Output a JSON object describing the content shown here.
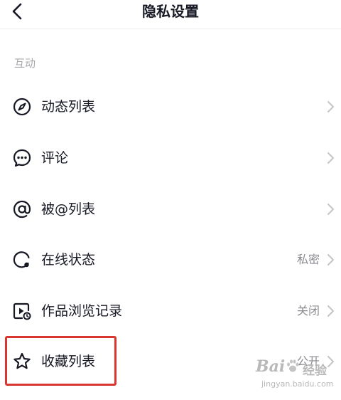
{
  "header": {
    "title": "隐私设置"
  },
  "section": {
    "title": "互动"
  },
  "rows": [
    {
      "label": "动态列表",
      "value": "",
      "icon": "compass-icon"
    },
    {
      "label": "评论",
      "value": "",
      "icon": "comment-icon"
    },
    {
      "label": "被@列表",
      "value": "",
      "icon": "at-icon"
    },
    {
      "label": "在线状态",
      "value": "私密",
      "icon": "online-status-icon"
    },
    {
      "label": "作品浏览记录",
      "value": "关闭",
      "icon": "video-history-icon"
    },
    {
      "label": "收藏列表",
      "value": "公开",
      "icon": "star-icon"
    }
  ],
  "watermark": {
    "brand": "Bai",
    "suffix": "经验",
    "url": "jingyan.baidu.com"
  },
  "colors": {
    "highlight": "#d9362f",
    "text": "#161823",
    "muted": "#8a8b91"
  }
}
